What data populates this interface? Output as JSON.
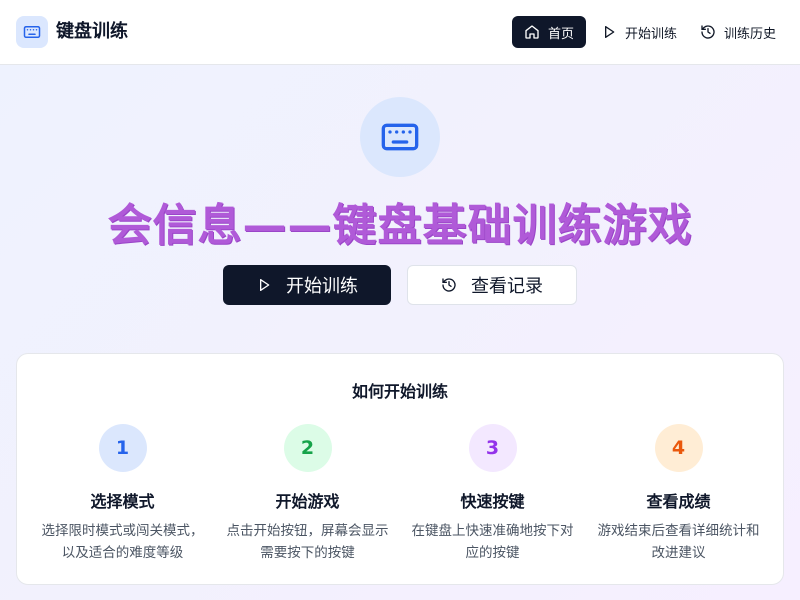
{
  "app": {
    "title": "键盘训练",
    "icon": "keyboard-icon"
  },
  "nav": {
    "home": {
      "label": "首页",
      "icon": "home-icon"
    },
    "start": {
      "label": "开始训练",
      "icon": "play-icon"
    },
    "history": {
      "label": "训练历史",
      "icon": "history-icon"
    }
  },
  "hero": {
    "icon": "keyboard-icon",
    "title": "会信息——键盘基础训练游戏",
    "primary_label": "开始训练",
    "secondary_label": "查看记录"
  },
  "howto": {
    "title": "如何开始训练",
    "steps": [
      {
        "num": "1",
        "title": "选择模式",
        "desc": "选择限时模式或闯关模式，以及适合的难度等级",
        "bg": "#dbe7fd",
        "fg": "#2563eb"
      },
      {
        "num": "2",
        "title": "开始游戏",
        "desc": "点击开始按钮，屏幕会显示需要按下的按键",
        "bg": "#dcfce7",
        "fg": "#16a34a"
      },
      {
        "num": "3",
        "title": "快速按键",
        "desc": "在键盘上快速准确地按下对应的按键",
        "bg": "#f3e8ff",
        "fg": "#9333ea"
      },
      {
        "num": "4",
        "title": "查看成绩",
        "desc": "游戏结束后查看详细统计和改进建议",
        "bg": "#ffedd5",
        "fg": "#ea580c"
      }
    ]
  },
  "colors": {
    "accent": "#0f172a",
    "title": "#b05ad8",
    "brand_blue": "#2563eb"
  }
}
